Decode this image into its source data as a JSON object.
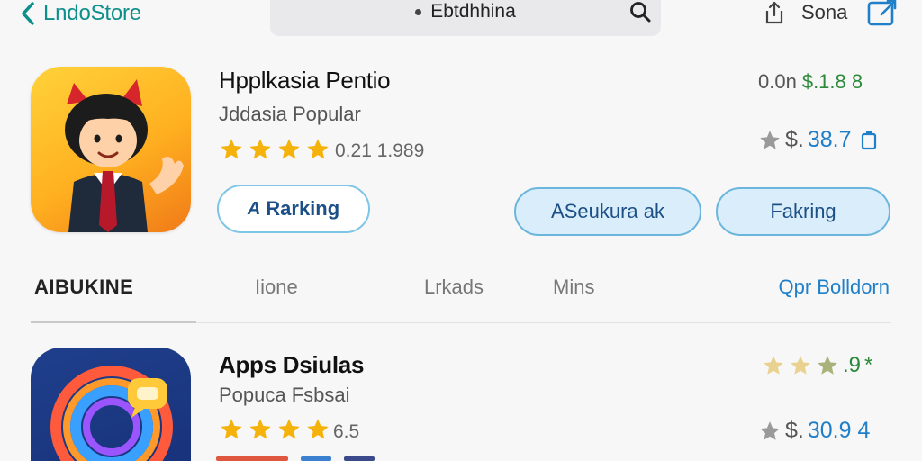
{
  "topbar": {
    "back_label": "LndoStore",
    "search_text": "Ebtdhhina",
    "share_label": "Sona"
  },
  "app1": {
    "title": "Hpplkasia Pentio",
    "subtitle": "Jddasia Popular",
    "rating_text": "0.21 1.989",
    "price_prefix": "0.0n",
    "price_value": "$.1.8 8",
    "price2_prefix": "$.",
    "price2_value": "38.7",
    "buttons": {
      "ranking": "Rarking",
      "ranking_glyph": "A",
      "seukara": "ASeukura ak",
      "faking": "Fakring"
    },
    "star_count": 4,
    "icon": "cartoon-character-icon"
  },
  "tabs": {
    "items": [
      "AIBUKINE",
      "Iione",
      "Lrkads",
      "Mins"
    ],
    "link": "Qpr Bolldorn",
    "active_index": 0
  },
  "app2": {
    "title": "Apps Dsiulas",
    "subtitle": "Popuca Fsbsai",
    "rating_text": "6.5",
    "score_value": ".9",
    "score_suffix": "*",
    "price_prefix": "$.",
    "price_value": "30.9 4",
    "star_count": 4,
    "icon": "chat-swirl-icon"
  },
  "colors": {
    "accent": "#0d8f8c",
    "link_blue": "#1f7fc9",
    "price_green": "#2d8a3a",
    "star_gold": "#f5b20a",
    "button_text": "#1c4f86"
  }
}
